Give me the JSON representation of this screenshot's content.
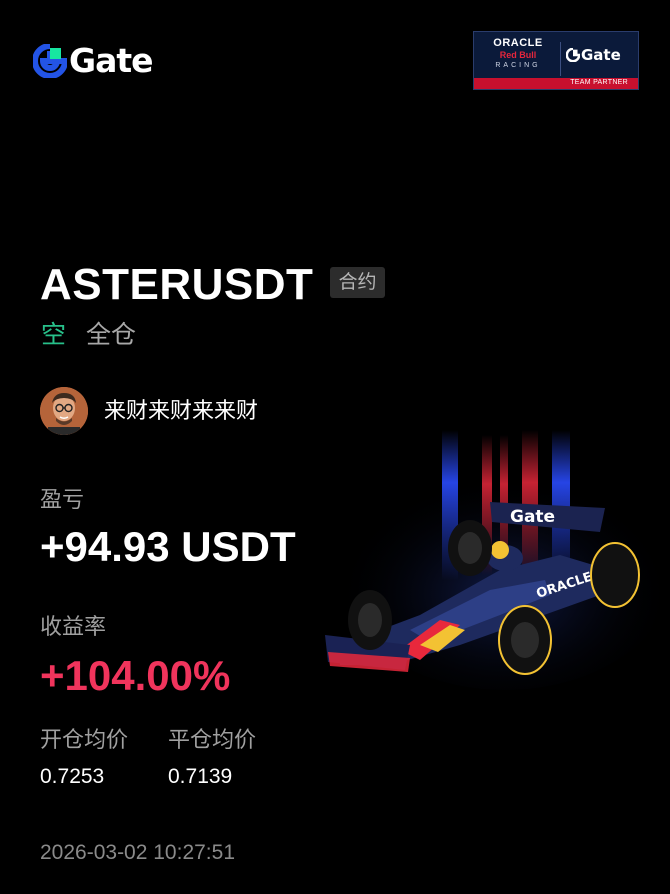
{
  "brand": {
    "name": "Gate",
    "accent": "#2354e6",
    "accent_green": "#17e6a1"
  },
  "partner_badge": {
    "oracle": "ORACLE",
    "redbull": "Red Bull",
    "racing": "RACING",
    "gate": "Gate",
    "caption": "TEAM PARTNER"
  },
  "position": {
    "symbol": "ASTERUSDT",
    "contract_tag": "合约",
    "side": "空",
    "side_color": "#27c08a",
    "margin_mode": "全仓"
  },
  "user": {
    "name": "来财来财来来财",
    "avatar_icon": "avatar-icon"
  },
  "pnl": {
    "label": "盈亏",
    "value": "+94.93 USDT"
  },
  "roi": {
    "label": "收益率",
    "value": "+104.00%",
    "color": "#f0345c"
  },
  "prices": {
    "open_label": "开仓均价",
    "open_value": "0.7253",
    "close_label": "平仓均价",
    "close_value": "0.7139"
  },
  "timestamp": "2026-03-02 10:27:51"
}
